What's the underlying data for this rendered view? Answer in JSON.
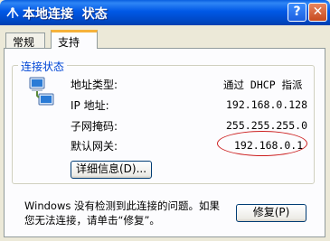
{
  "window": {
    "title": "本地连接  状态",
    "help_button": "?",
    "close_button": "✕"
  },
  "tabs": [
    {
      "label": "常规",
      "active": false
    },
    {
      "label": "支持",
      "active": true
    }
  ],
  "group": {
    "title": "连接状态",
    "rows": [
      {
        "label": "地址类型:",
        "value": "通过 DHCP 指派"
      },
      {
        "label": "IP 地址:",
        "value": "192.168.0.128"
      },
      {
        "label": "子网掩码:",
        "value": "255.255.255.0"
      },
      {
        "label": "默认网关:",
        "value": "192.168.0.1"
      }
    ],
    "details_button": "详细信息(D)..."
  },
  "hint": {
    "line1": "Windows 没有检测到此连接的问题。如果",
    "line2": "您无法连接，请单击“修复”。"
  },
  "repair_button": "修复(P)",
  "colors": {
    "titlebar": "#0058e6",
    "group_title": "#0046d5",
    "highlight_ellipse": "#cc1f1f",
    "tab_accent": "#f6b23a"
  }
}
